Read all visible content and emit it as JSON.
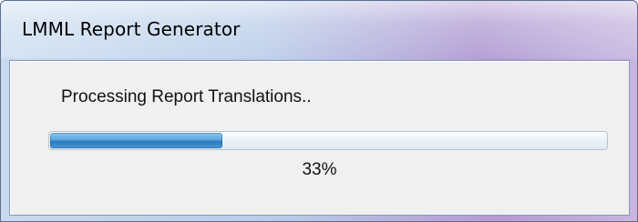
{
  "window": {
    "title": "LMML Report Generator"
  },
  "dialog": {
    "status_text": "Processing Report Translations..",
    "progress": {
      "value": 0.31,
      "label": "33%"
    }
  },
  "colors": {
    "progress_fill": "#3a8ad0",
    "client_bg": "#f0f0f0"
  }
}
